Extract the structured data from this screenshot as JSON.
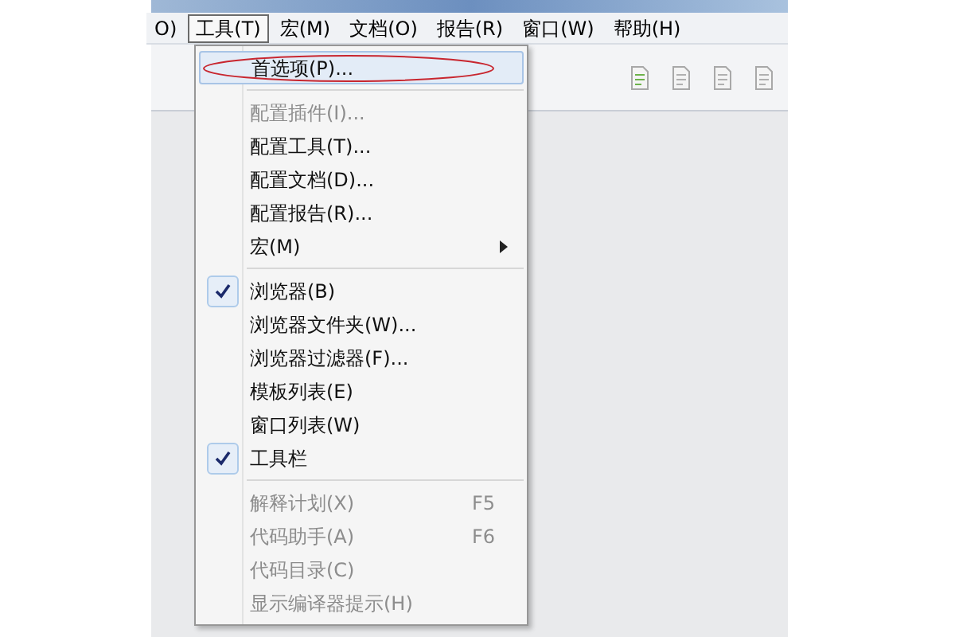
{
  "menu_bar": [
    {
      "label": "O)",
      "selected": false
    },
    {
      "label": "工具(T)",
      "selected": true
    },
    {
      "label": "宏(M)",
      "selected": false
    },
    {
      "label": "文档(O)",
      "selected": false
    },
    {
      "label": "报告(R)",
      "selected": false
    },
    {
      "label": "窗口(W)",
      "selected": false
    },
    {
      "label": "帮助(H)",
      "selected": false
    }
  ],
  "dropdown": [
    {
      "kind": "item",
      "label": "首选项(P)...",
      "disabled": false,
      "checked": false,
      "annotated": true
    },
    {
      "kind": "separator"
    },
    {
      "kind": "item",
      "label": "配置插件(I)...",
      "disabled": true,
      "checked": false
    },
    {
      "kind": "item",
      "label": "配置工具(T)...",
      "disabled": false,
      "checked": false
    },
    {
      "kind": "item",
      "label": "配置文档(D)...",
      "disabled": false,
      "checked": false
    },
    {
      "kind": "item",
      "label": "配置报告(R)...",
      "disabled": false,
      "checked": false
    },
    {
      "kind": "item",
      "label": "宏(M)",
      "disabled": false,
      "checked": false,
      "submenu": true
    },
    {
      "kind": "separator"
    },
    {
      "kind": "item",
      "label": "浏览器(B)",
      "disabled": false,
      "checked": true
    },
    {
      "kind": "item",
      "label": "浏览器文件夹(W)...",
      "disabled": false,
      "checked": false
    },
    {
      "kind": "item",
      "label": "浏览器过滤器(F)...",
      "disabled": false,
      "checked": false
    },
    {
      "kind": "item",
      "label": "模板列表(E)",
      "disabled": false,
      "checked": false
    },
    {
      "kind": "item",
      "label": "窗口列表(W)",
      "disabled": false,
      "checked": false
    },
    {
      "kind": "item",
      "label": "工具栏",
      "disabled": false,
      "checked": true
    },
    {
      "kind": "separator"
    },
    {
      "kind": "item",
      "label": "解释计划(X)",
      "disabled": true,
      "checked": false,
      "shortcut": "F5"
    },
    {
      "kind": "item",
      "label": "代码助手(A)",
      "disabled": true,
      "checked": false,
      "shortcut": "F6"
    },
    {
      "kind": "item",
      "label": "代码目录(C)",
      "disabled": true,
      "checked": false
    },
    {
      "kind": "item",
      "label": "显示编译器提示(H)",
      "disabled": true,
      "checked": false
    }
  ]
}
